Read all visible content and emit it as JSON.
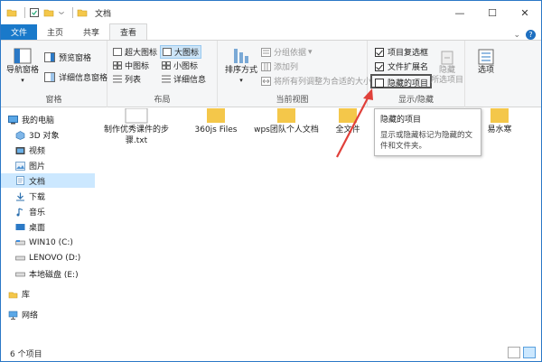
{
  "window": {
    "title": "文档"
  },
  "window_controls": {
    "minimize": "—",
    "maximize": "☐",
    "close": "✕"
  },
  "tabs": [
    {
      "label": "文件"
    },
    {
      "label": "主页"
    },
    {
      "label": "共享"
    },
    {
      "label": "查看"
    }
  ],
  "ribbon": {
    "panes": {
      "label": "窗格",
      "nav_pane": "导航窗格",
      "preview_pane": "预览窗格",
      "details_pane": "详细信息窗格"
    },
    "layout": {
      "label": "布局",
      "items": [
        "超大图标",
        "大图标",
        "中图标",
        "小图标",
        "列表",
        "详细信息"
      ]
    },
    "current_view": {
      "label": "当前视图",
      "sort_by": "排序方式",
      "group_by": "分组依据",
      "add_columns": "添加列",
      "size_all_columns": "将所有列调整为合适的大小"
    },
    "show_hide": {
      "label": "显示/隐藏",
      "item_checkboxes": "项目复选框",
      "file_name_extensions": "文件扩展名",
      "hidden_items": "隐藏的项目",
      "hide_selected": "隐藏",
      "hide_selected_2": "所选项目",
      "options": "选项"
    }
  },
  "tooltip": {
    "title": "隐藏的项目",
    "body": "显示或隐藏标记为隐藏的文件和文件夹。"
  },
  "sidebar": {
    "items": [
      {
        "label": "我的电脑"
      },
      {
        "label": "3D 对象"
      },
      {
        "label": "视频"
      },
      {
        "label": "图片"
      },
      {
        "label": "文档"
      },
      {
        "label": "下载"
      },
      {
        "label": "音乐"
      },
      {
        "label": "桌面"
      },
      {
        "label": "WIN10 (C:)"
      },
      {
        "label": "LENOVO (D:)"
      },
      {
        "label": "本地磁盘 (E:)"
      },
      {
        "label": "库"
      },
      {
        "label": "网络"
      }
    ]
  },
  "files": [
    {
      "name": "制作优秀课件的步骤.txt"
    },
    {
      "name": "360js Files"
    },
    {
      "name": "wps团队个人文档"
    },
    {
      "name": "全文件"
    },
    {
      "name": "易水寒"
    }
  ],
  "status": {
    "count": "6 个项目"
  },
  "colors": {
    "accent": "#1979ca",
    "arrow": "#e0403a",
    "folder": "#f4c74a"
  }
}
